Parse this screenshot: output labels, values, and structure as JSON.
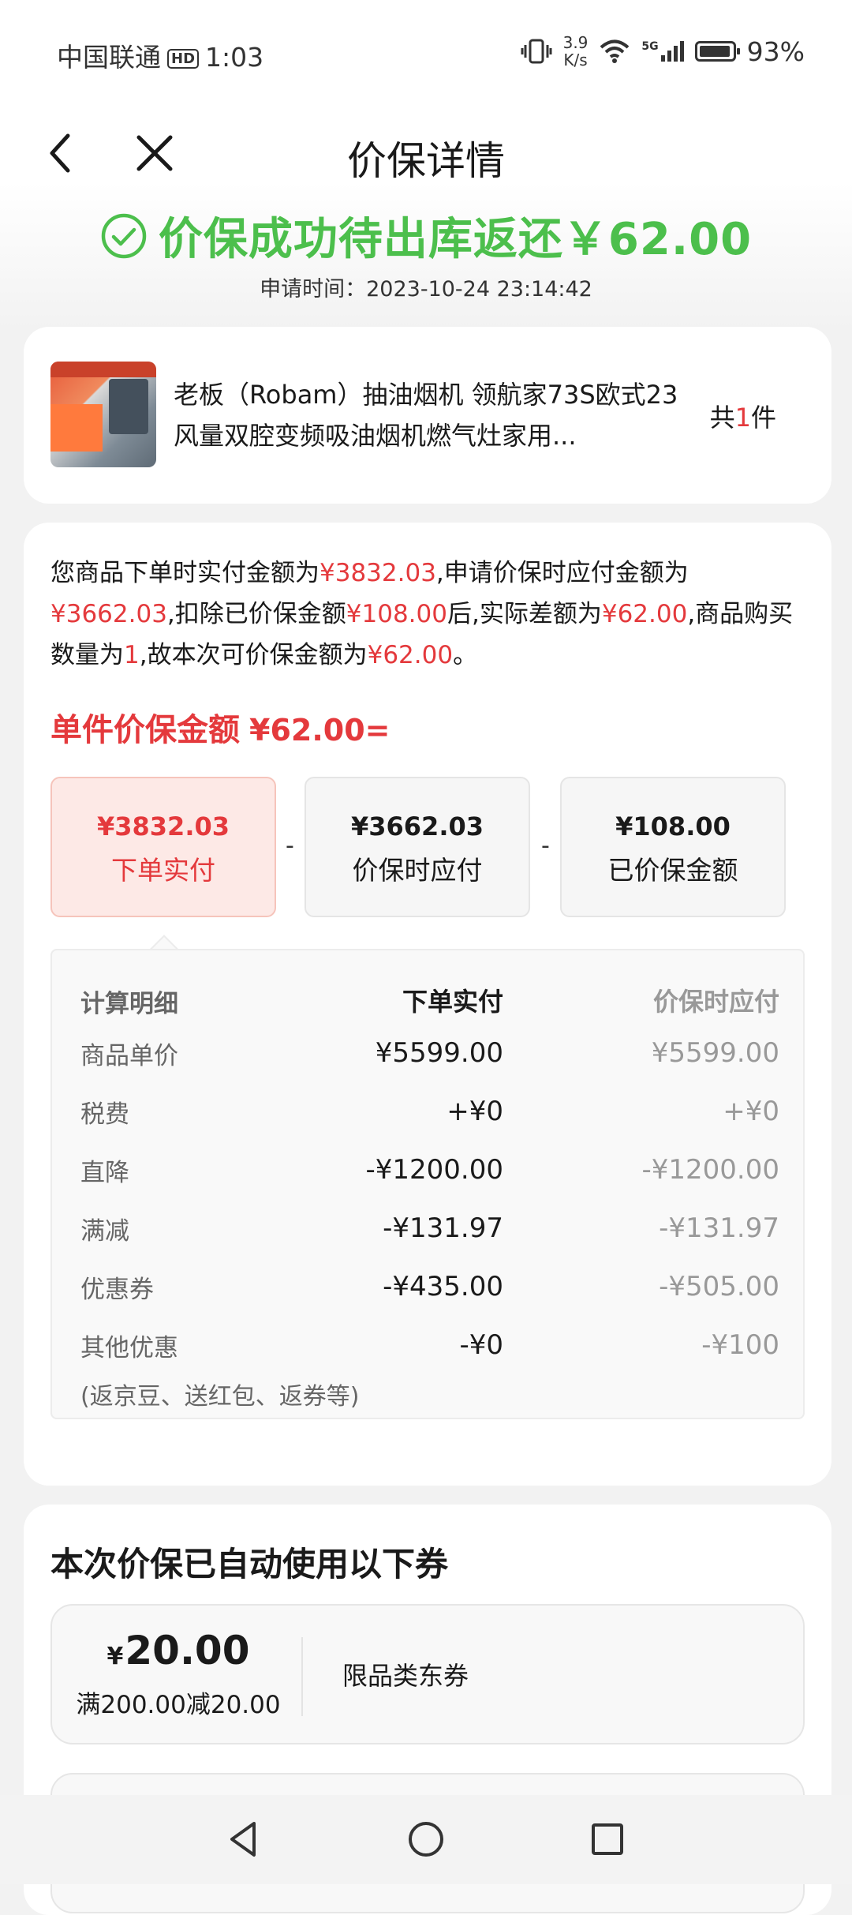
{
  "status_bar": {
    "carrier": "中国联通",
    "hd": "HD",
    "time": "1:03",
    "net_speed_value": "3.9",
    "net_speed_unit": "K/s",
    "signal_label": "5G",
    "battery": "93%"
  },
  "nav": {
    "title": "价保详情"
  },
  "result": {
    "status_text": "价保成功待出库返还￥62.00",
    "apply_time": "申请时间：2023-10-24 23:14:42",
    "accent_color": "#4cbf4c"
  },
  "product": {
    "name": "老板（Robam）抽油烟机 领航家73S欧式23风量双腔变频吸油烟机燃气灶家用...",
    "count_prefix": "共",
    "count_value": "1",
    "count_suffix": "件"
  },
  "calculation": {
    "explain_parts": [
      "您商品下单时实付金额为",
      "¥3832.03",
      ",申请价保时应付金额为",
      "¥3662.03",
      ",扣除已价保金额",
      "¥108.00",
      "后,实际差额为",
      "¥62.00",
      ",商品购买数量为",
      "1",
      ",故本次可价保金额为",
      "¥62.00",
      "。"
    ],
    "unit_heading": "单件价保金额",
    "unit_value": "¥62.00=",
    "boxes": [
      {
        "value": "¥3832.03",
        "label": "下单实付"
      },
      {
        "value": "¥3662.03",
        "label": "价保时应付"
      },
      {
        "value": "¥108.00",
        "label": "已价保金额"
      }
    ],
    "operators": [
      "-",
      "-"
    ],
    "detail": {
      "headers": [
        "计算明细",
        "下单实付",
        "价保时应付"
      ],
      "rows": [
        {
          "label": "商品单价",
          "paid": "¥5599.00",
          "now": "¥5599.00"
        },
        {
          "label": "税费",
          "paid": "+¥0",
          "now": "+¥0"
        },
        {
          "label": "直降",
          "paid": "-¥1200.00",
          "now": "-¥1200.00"
        },
        {
          "label": "满减",
          "paid": "-¥131.97",
          "now": "-¥131.97"
        },
        {
          "label": "优惠券",
          "paid": "-¥435.00",
          "now": "-¥505.00"
        },
        {
          "label": "其他优惠",
          "paid": "-¥0",
          "now": "-¥100"
        }
      ],
      "note": "(返京豆、送红包、返券等)"
    }
  },
  "coupons": {
    "heading": "本次价保已自动使用以下券",
    "items": [
      {
        "currency": "¥",
        "amount": "20.00",
        "condition": "满200.00减20.00",
        "type": "限品类东券"
      }
    ]
  },
  "colors": {
    "price_red": "#e4393c",
    "success_green": "#4cbf4c"
  }
}
